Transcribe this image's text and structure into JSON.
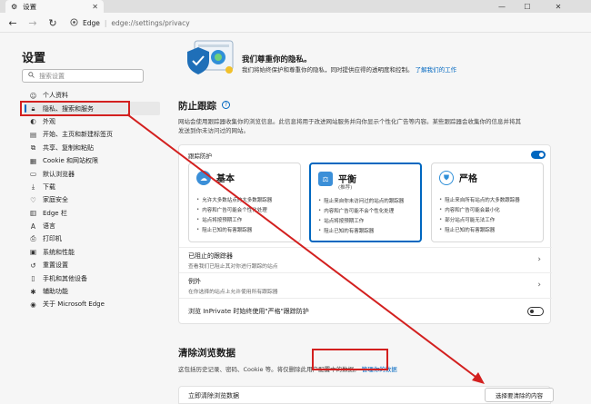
{
  "browser": {
    "tab_title": "设置",
    "address_site": "Edge",
    "address_url": "edge://settings/privacy"
  },
  "sidebar": {
    "title": "设置",
    "search_placeholder": "搜索设置",
    "items": [
      {
        "label": "个人资料",
        "icon": "profile-icon",
        "active": false
      },
      {
        "label": "隐私、搜索和服务",
        "icon": "lock-icon",
        "active": true
      },
      {
        "label": "外观",
        "icon": "appearance-icon",
        "active": false
      },
      {
        "label": "开始、主页和新建标签页",
        "icon": "home-icon",
        "active": false
      },
      {
        "label": "共享、复制和粘贴",
        "icon": "share-icon",
        "active": false
      },
      {
        "label": "Cookie 和网站权限",
        "icon": "cookie-icon",
        "active": false
      },
      {
        "label": "默认浏览器",
        "icon": "browser-icon",
        "active": false
      },
      {
        "label": "下载",
        "icon": "download-icon",
        "active": false
      },
      {
        "label": "家庭安全",
        "icon": "family-icon",
        "active": false
      },
      {
        "label": "Edge 栏",
        "icon": "edge-bar-icon",
        "active": false
      },
      {
        "label": "语言",
        "icon": "language-icon",
        "active": false
      },
      {
        "label": "打印机",
        "icon": "printer-icon",
        "active": false
      },
      {
        "label": "系统和性能",
        "icon": "system-icon",
        "active": false
      },
      {
        "label": "重置设置",
        "icon": "reset-icon",
        "active": false
      },
      {
        "label": "手机和其他设备",
        "icon": "phone-icon",
        "active": false
      },
      {
        "label": "辅助功能",
        "icon": "accessibility-icon",
        "active": false
      },
      {
        "label": "关于 Microsoft Edge",
        "icon": "edge-logo-icon",
        "active": false
      }
    ]
  },
  "hero": {
    "title": "我们尊重你的隐私。",
    "desc": "我们将始终保护和尊重你的隐私，同时提供应得的透明度和控制。",
    "link": "了解我们的工作"
  },
  "tracking": {
    "heading": "防止跟踪",
    "desc_line1": "网站会使用跟踪器收集你的浏览信息。此信息将用于改进网站服务并向你显示个性化广告等内容。某些跟踪器会收集你的信息并将其",
    "desc_line2": "发送到你未访问过的网站。",
    "card_label": "跟踪防护",
    "toggle_on": true,
    "levels": [
      {
        "title": "基本",
        "subtitle": "",
        "selected": false,
        "icon": "basic-icon",
        "bullets": [
          "允许大多数站点的大多数跟踪器",
          "内容和广告可能会个性化处理",
          "站点将按预期工作",
          "阻止已知的有害跟踪器"
        ]
      },
      {
        "title": "平衡",
        "subtitle": "(推荐)",
        "selected": true,
        "icon": "balance-icon",
        "bullets": [
          "阻止来自你未访问过的站点的跟踪器",
          "内容和广告可能不会个性化处理",
          "站点将按预期工作",
          "阻止已知的有害跟踪器"
        ]
      },
      {
        "title": "严格",
        "subtitle": "",
        "selected": false,
        "icon": "strict-icon",
        "bullets": [
          "阻止来自所有站点的大多数跟踪器",
          "内容和广告可能会最小化",
          "部分站点可能无法工作",
          "阻止已知的有害跟踪器"
        ]
      }
    ],
    "blocked": {
      "title": "已阻止的跟踪器",
      "sub": "查看我们已阻止其对你进行跟踪的站点"
    },
    "exceptions": {
      "title": "例外",
      "sub": "在你选择的站点上允许使用所有跟踪器"
    },
    "inprivate": {
      "title": "浏览 InPrivate 时始终使用\"严格\"跟踪防护",
      "toggle_on": false
    }
  },
  "clear": {
    "heading": "清除浏览数据",
    "desc": "这包括历史记录、密码、Cookie 等。将仅删除此用户配置中的数据。",
    "link": "管理你的数据",
    "row_label": "立即清除浏览数据",
    "button": "选择要清除的内容"
  },
  "colors": {
    "accent": "#0067c0",
    "annotation_red": "#d3201f"
  }
}
